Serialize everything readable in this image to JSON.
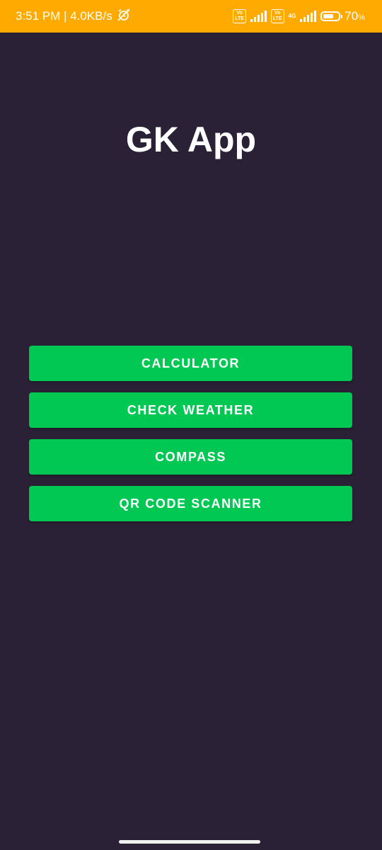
{
  "status_bar": {
    "time_speed": "3:51 PM | 4.0KB/s",
    "sim1_badge": "Vo\nLTE",
    "sim2_badge": "Vo\nLTE",
    "network_type": "4G",
    "battery_percent": "70",
    "battery_unit": "%",
    "battery_level": 0.7,
    "bg_color": "#ffaa00"
  },
  "app": {
    "title": "GK App",
    "background": "#2a2136",
    "accent": "#00c853"
  },
  "menu": {
    "buttons": [
      {
        "label": "CALCULATOR"
      },
      {
        "label": "CHECK WEATHER"
      },
      {
        "label": "COMPASS"
      },
      {
        "label": "QR CODE SCANNER"
      }
    ]
  }
}
